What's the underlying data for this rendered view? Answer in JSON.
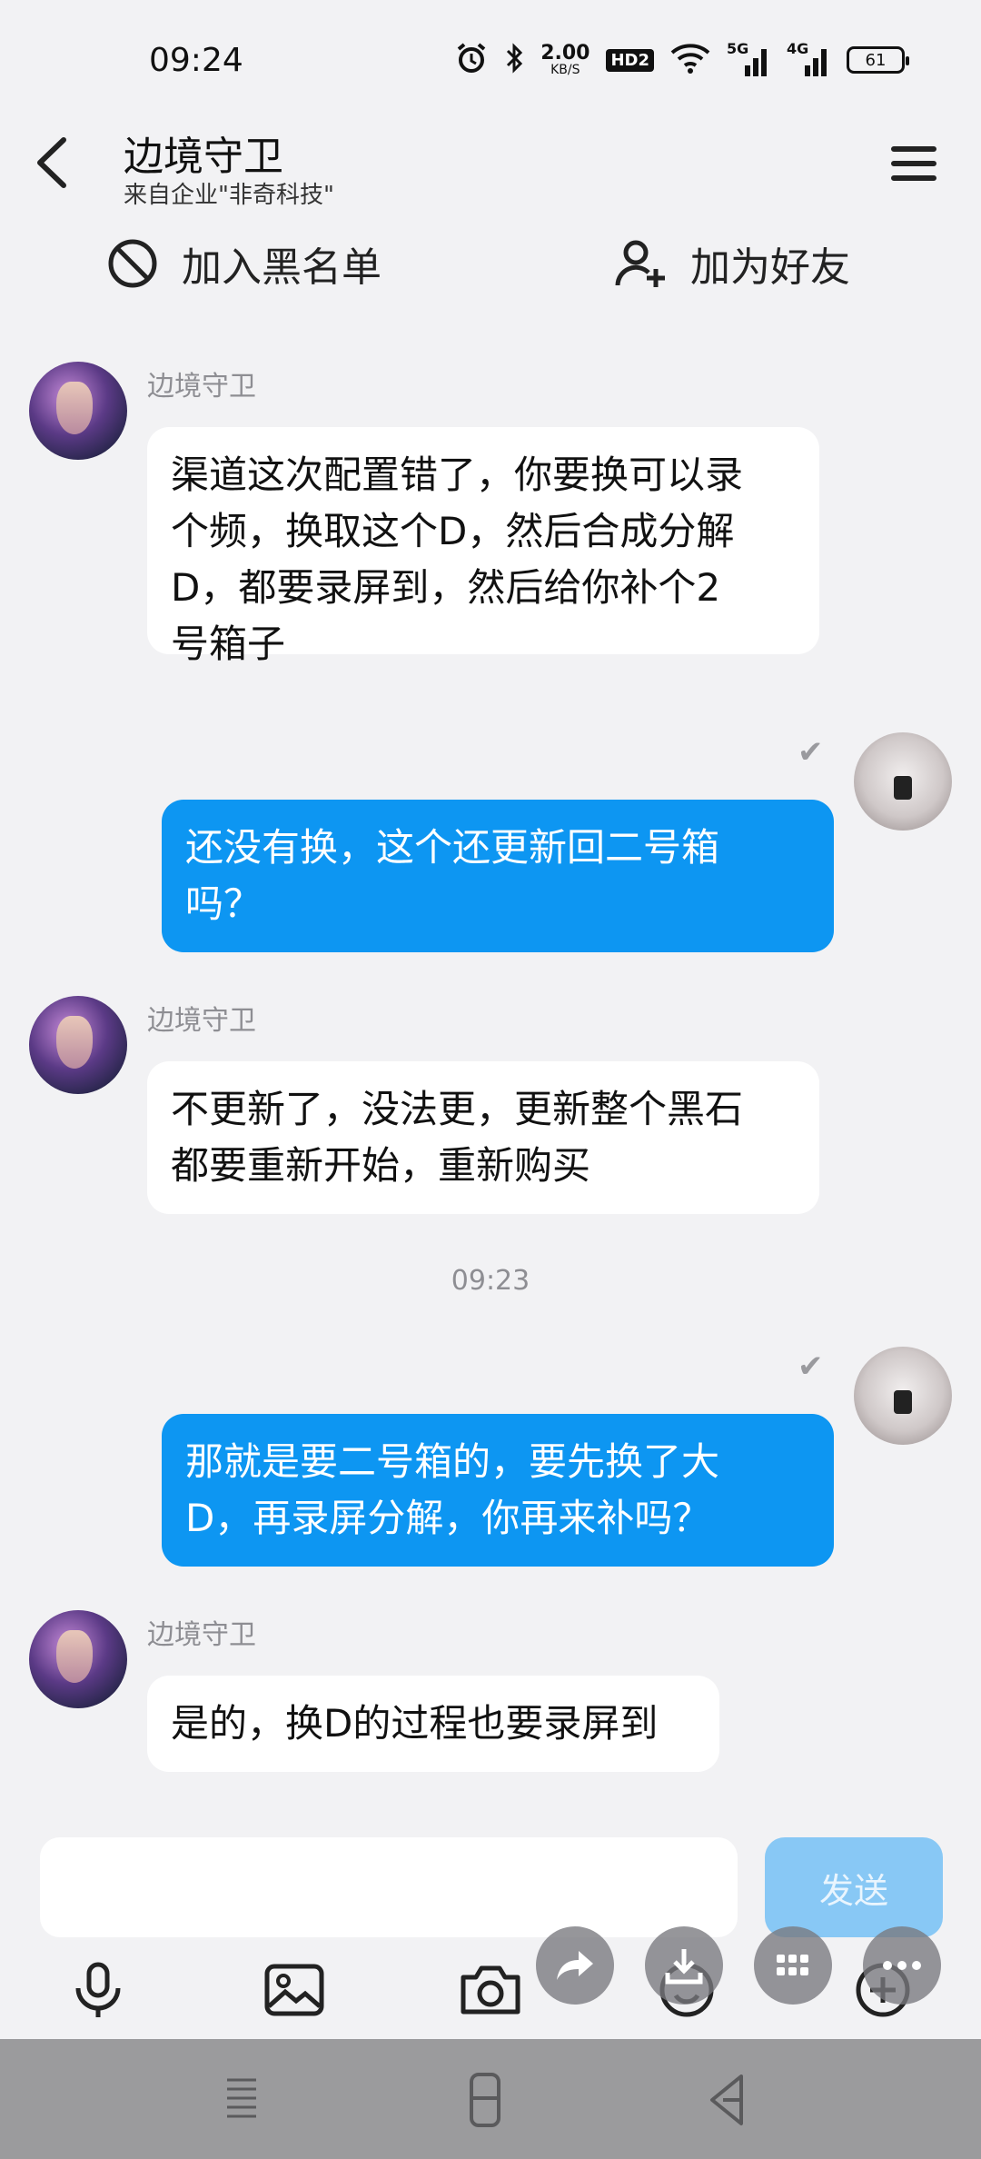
{
  "status_bar": {
    "time": "09:24",
    "net_speed_value": "2.00",
    "net_speed_unit": "KB/S",
    "hd_badge": "HD2",
    "signal_1": "5G",
    "signal_2": "4G",
    "battery": "61"
  },
  "header": {
    "title": "边境守卫",
    "subtitle": "来自企业\"非奇科技\""
  },
  "actions": {
    "block_label": "加入黑名单",
    "add_friend_label": "加为好友"
  },
  "messages": [
    {
      "direction": "in",
      "sender": "边境守卫",
      "lines": [
        "渠道这次配置错了，你要换可以录",
        "个频，换取这个D，然后合成分解",
        "D，都要录屏到，然后给你补个2",
        "号箱子"
      ]
    },
    {
      "direction": "out",
      "status": "✔",
      "lines": [
        "还没有换，这个还更新回二号箱",
        "吗？"
      ]
    },
    {
      "direction": "in",
      "sender": "边境守卫",
      "lines": [
        "不更新了，没法更，更新整个黑石",
        "都要重新开始，重新购买"
      ]
    },
    {
      "type": "timestamp",
      "text": "09:23"
    },
    {
      "direction": "out",
      "status": "✔",
      "lines": [
        "那就是要二号箱的，要先换了大",
        "D，再录屏分解，你再来补吗？"
      ]
    },
    {
      "direction": "in",
      "sender": "边境守卫",
      "lines": [
        "是的，换D的过程也要录屏到"
      ]
    }
  ],
  "input": {
    "placeholder": "",
    "send_label": "发送"
  },
  "accent_color": "#0d96f2"
}
